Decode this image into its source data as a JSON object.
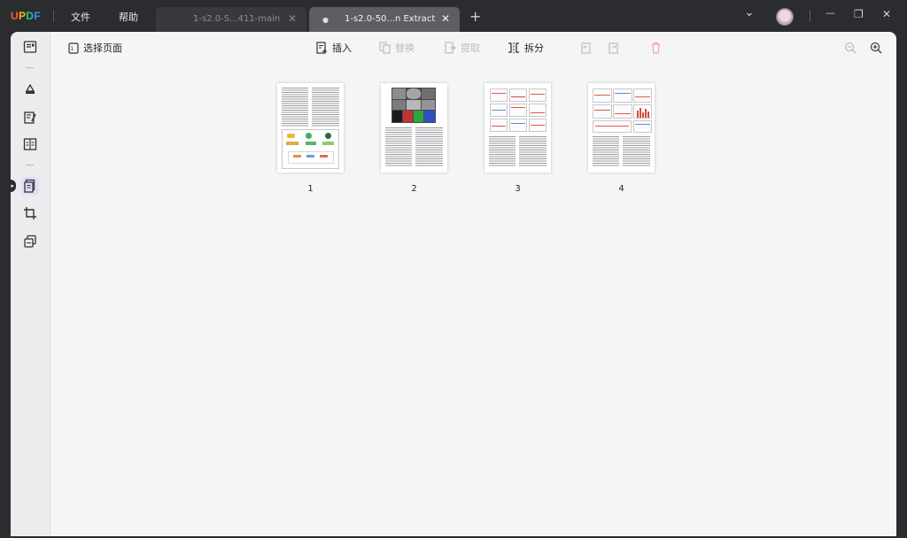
{
  "app": {
    "logo": {
      "u": "U",
      "p": "P",
      "d": "D",
      "f": "F"
    },
    "menus": [
      {
        "label": "文件"
      },
      {
        "label": "帮助"
      }
    ],
    "tabs": [
      {
        "label": "1-s2.0-S...411-main",
        "active": false
      },
      {
        "label": "1-s2.0-50...n Extract",
        "active": true
      }
    ],
    "icons": {
      "add_tab": "+",
      "chevron": "⌄",
      "close": "✕",
      "minimize": "—",
      "restore": "❐",
      "unsaved_dot": "●"
    }
  },
  "toolbar": {
    "select_pages": "选择页面",
    "insert": "插入",
    "replace": "替换",
    "extract": "提取",
    "split": "拆分"
  },
  "pages": [
    {
      "number": "1"
    },
    {
      "number": "2"
    },
    {
      "number": "3"
    },
    {
      "number": "4"
    }
  ],
  "colors": {
    "accent": "#7b5cf0",
    "titlebar": "#2b2c30",
    "canvas": "#f5f5f6",
    "sidebar_active": "#e5dcfb"
  }
}
